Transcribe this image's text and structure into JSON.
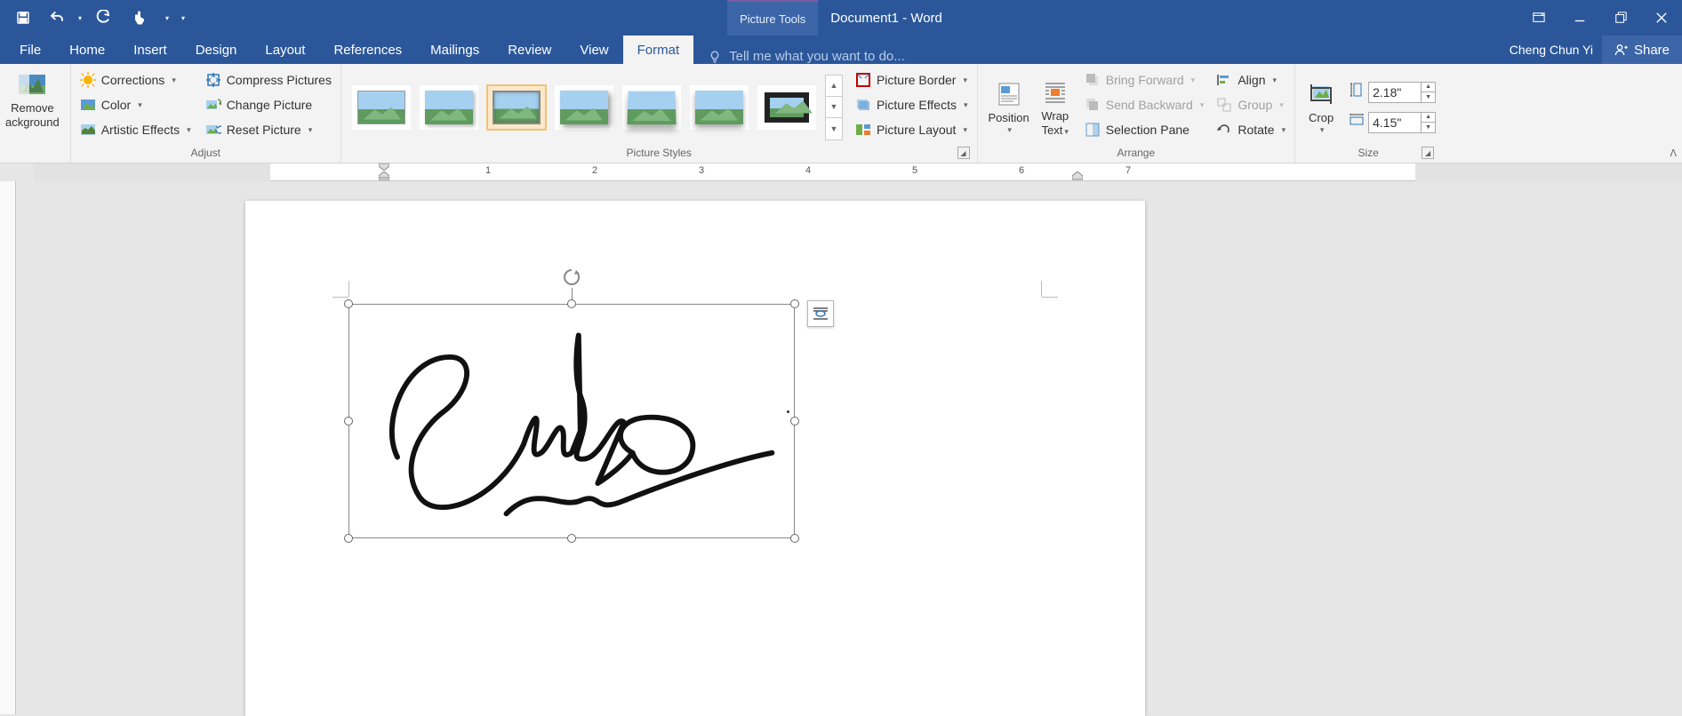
{
  "titlebar": {
    "picture_tools": "Picture Tools",
    "document_title": "Document1 - Word"
  },
  "tabs": {
    "file": "File",
    "home": "Home",
    "insert": "Insert",
    "design": "Design",
    "layout": "Layout",
    "references": "References",
    "mailings": "Mailings",
    "review": "Review",
    "view": "View",
    "format": "Format",
    "tellme": "Tell me what you want to do..."
  },
  "user": {
    "name": "Cheng Chun Yi",
    "share": "Share"
  },
  "ribbon": {
    "remove_bg_l1": "Remove",
    "remove_bg_l2": "ackground",
    "adjust": {
      "corrections": "Corrections",
      "color": "Color",
      "artistic": "Artistic Effects",
      "compress": "Compress Pictures",
      "change": "Change Picture",
      "reset": "Reset Picture",
      "label": "Adjust"
    },
    "styles": {
      "border": "Picture Border",
      "effects": "Picture Effects",
      "layout": "Picture Layout",
      "label": "Picture Styles"
    },
    "arrange": {
      "position": "Position",
      "wrap_l1": "Wrap",
      "wrap_l2": "Text",
      "bring_fwd": "Bring Forward",
      "send_back": "Send Backward",
      "sel_pane": "Selection Pane",
      "align": "Align",
      "group": "Group",
      "rotate": "Rotate",
      "label": "Arrange"
    },
    "size": {
      "crop": "Crop",
      "height": "2.18\"",
      "width": "4.15\"",
      "label": "Size"
    }
  },
  "ruler": {
    "n1": "1",
    "n2": "2",
    "n3": "3",
    "n4": "4",
    "n5": "5",
    "n6": "6",
    "n7": "7"
  }
}
